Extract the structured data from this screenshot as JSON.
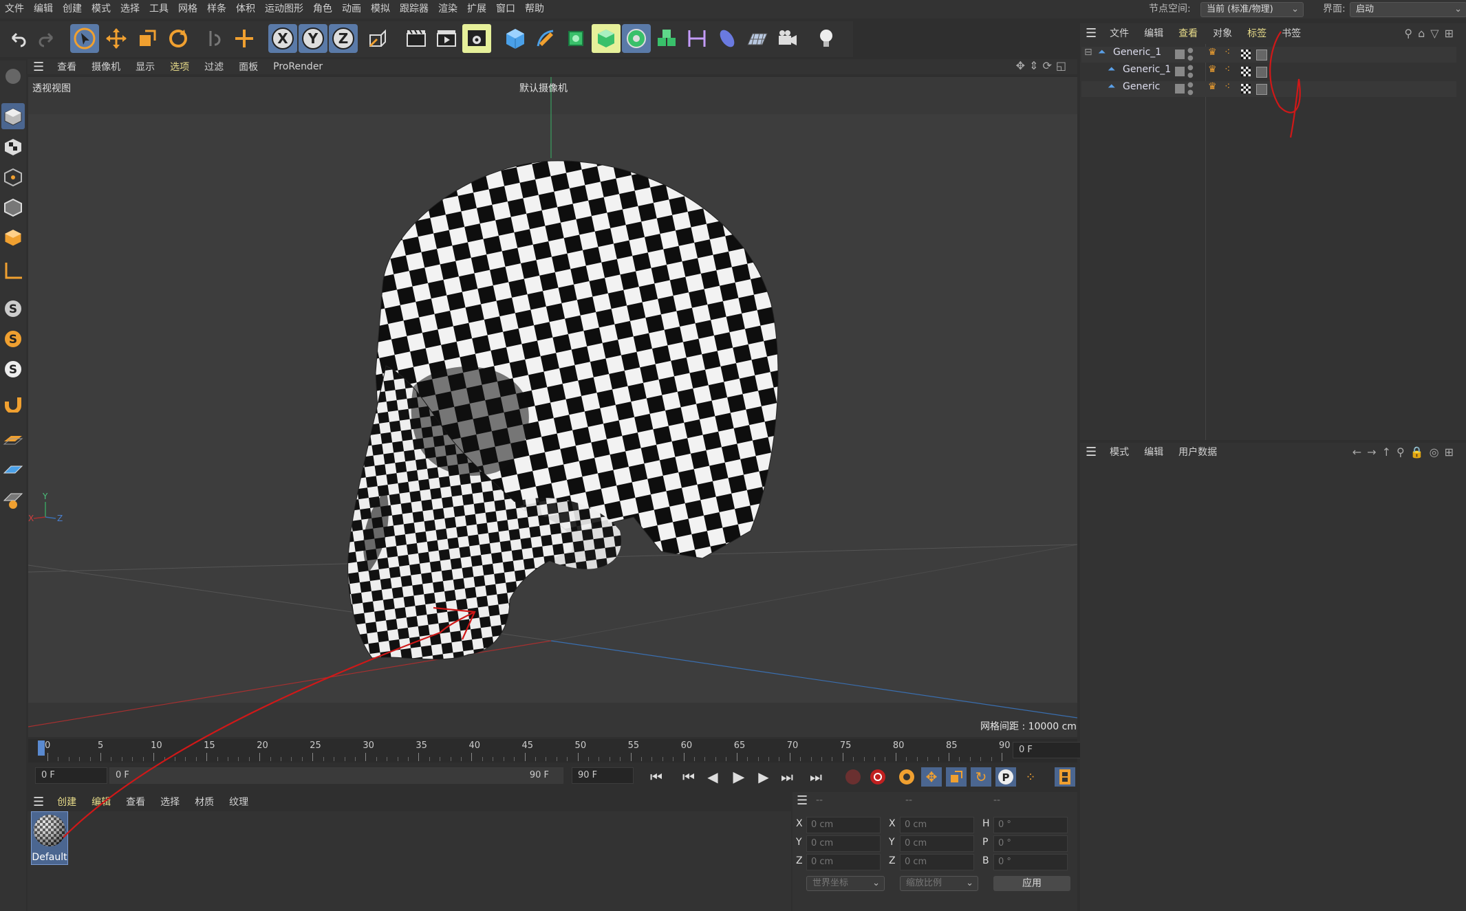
{
  "menubar": {
    "items": [
      "文件",
      "编辑",
      "创建",
      "模式",
      "选择",
      "工具",
      "网格",
      "样条",
      "体积",
      "运动图形",
      "角色",
      "动画",
      "模拟",
      "跟踪器",
      "渲染",
      "扩展",
      "窗口",
      "帮助"
    ],
    "node_space_label": "节点空间:",
    "node_space_value": "当前 (标准/物理)",
    "interface_label": "界面:",
    "interface_value": "启动"
  },
  "viewport": {
    "menu": [
      "查看",
      "摄像机",
      "显示",
      "选项",
      "过滤",
      "面板",
      "ProRender"
    ],
    "title": "透视视图",
    "camera": "默认摄像机",
    "grid_spacing": "网格间距 : 10000 cm",
    "axis_labels": {
      "x": "X",
      "y": "Y",
      "z": "Z"
    }
  },
  "timeline": {
    "ticks": [
      "0",
      "5",
      "10",
      "15",
      "20",
      "25",
      "30",
      "35",
      "40",
      "45",
      "50",
      "55",
      "60",
      "65",
      "70",
      "75",
      "80",
      "85",
      "90"
    ],
    "current_frame": "0 F",
    "start_frame": "0 F",
    "range_start": "0 F",
    "range_end": "90 F",
    "end_frame": "90 F"
  },
  "material_manager": {
    "menu": [
      "创建",
      "编辑",
      "查看",
      "选择",
      "材质",
      "纹理"
    ],
    "materials": [
      {
        "name": "Default"
      }
    ]
  },
  "coordinates": {
    "headers": [
      "--",
      "--",
      "--"
    ],
    "rows": [
      {
        "l1": "X",
        "v1": "0 cm",
        "l2": "X",
        "v2": "0 cm",
        "l3": "H",
        "v3": "0 °"
      },
      {
        "l1": "Y",
        "v1": "0 cm",
        "l2": "Y",
        "v2": "0 cm",
        "l3": "P",
        "v3": "0 °"
      },
      {
        "l1": "Z",
        "v1": "0 cm",
        "l2": "Z",
        "v2": "0 cm",
        "l3": "B",
        "v3": "0 °"
      }
    ],
    "coord_system": "世界坐标",
    "scale_mode": "缩放比例",
    "apply": "应用"
  },
  "object_manager": {
    "menu": [
      "文件",
      "编辑",
      "查看",
      "对象",
      "标签",
      "书签"
    ],
    "objects": [
      {
        "name": "Generic_1",
        "indent": 0
      },
      {
        "name": "Generic_1",
        "indent": 1
      },
      {
        "name": "Generic",
        "indent": 1
      }
    ]
  },
  "attribute_manager": {
    "menu": [
      "模式",
      "编辑",
      "用户数据"
    ]
  },
  "colors": {
    "accent_orange": "#f0a030",
    "selection_blue": "#5a7aa8",
    "annotation_red": "#d01818"
  }
}
